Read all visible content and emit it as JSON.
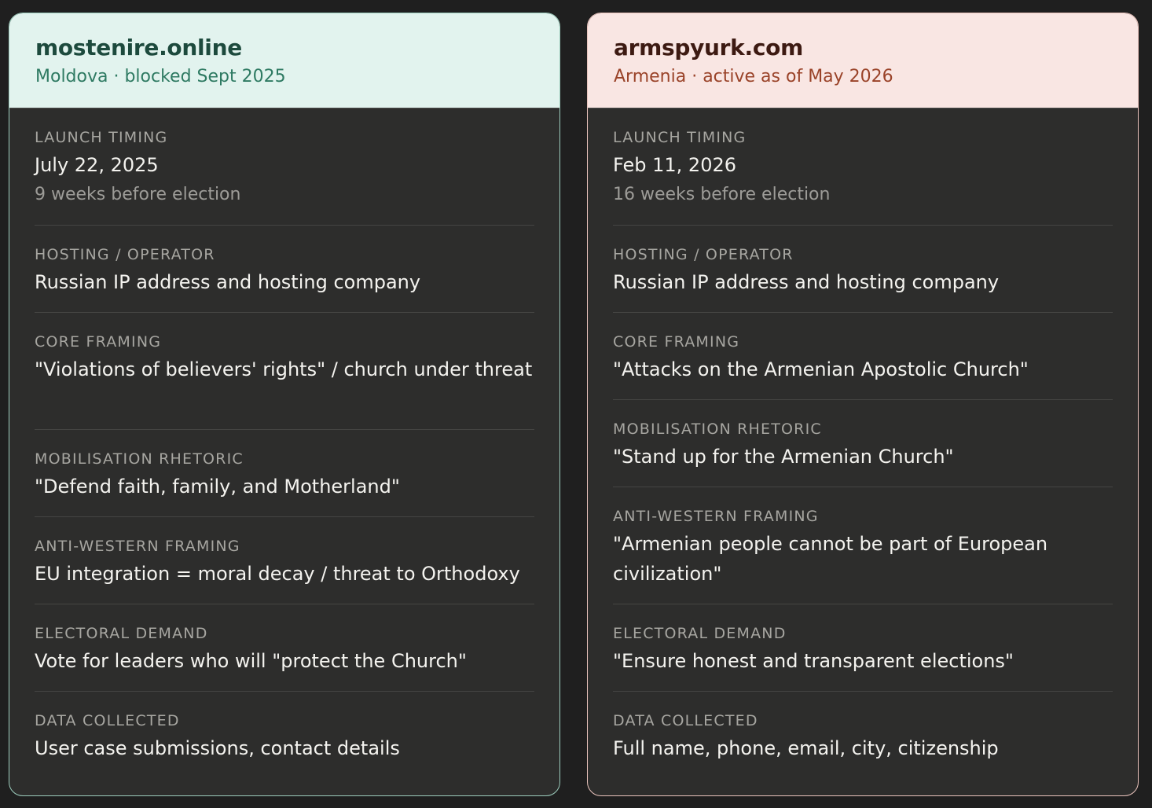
{
  "cards": [
    {
      "domain": "mostenire.online",
      "subtitle": "Moldova · blocked Sept 2025",
      "accent": "#e2f3ee",
      "rows": [
        {
          "label": "LAUNCH TIMING",
          "value": "July 22, 2025",
          "note": "9 weeks before election"
        },
        {
          "label": "HOSTING / OPERATOR",
          "value": "Russian IP address and hosting company"
        },
        {
          "label": "CORE FRAMING",
          "value": "\"Violations of believers' rights\" / church under threat"
        },
        {
          "label": "MOBILISATION RHETORIC",
          "value": "\"Defend faith, family, and Motherland\""
        },
        {
          "label": "ANTI-WESTERN FRAMING",
          "value": "EU integration = moral decay / threat to Orthodoxy"
        },
        {
          "label": "ELECTORAL DEMAND",
          "value": "Vote for leaders who will \"protect the Church\""
        },
        {
          "label": "DATA COLLECTED",
          "value": "User case submissions, contact details"
        }
      ]
    },
    {
      "domain": "armspyurk.com",
      "subtitle": "Armenia · active as of May 2026",
      "accent": "#f9e6e3",
      "rows": [
        {
          "label": "LAUNCH TIMING",
          "value": "Feb 11, 2026",
          "note": "16 weeks before election"
        },
        {
          "label": "HOSTING / OPERATOR",
          "value": "Russian IP address and hosting company"
        },
        {
          "label": "CORE FRAMING",
          "value": "\"Attacks on the Armenian Apostolic Church\""
        },
        {
          "label": "MOBILISATION RHETORIC",
          "value": "\"Stand up for the Armenian Church\""
        },
        {
          "label": "ANTI-WESTERN FRAMING",
          "value": "\"Armenian people cannot be part of European civilization\""
        },
        {
          "label": "ELECTORAL DEMAND",
          "value": "\"Ensure honest and transparent elections\""
        },
        {
          "label": "DATA COLLECTED",
          "value": "Full name, phone, email, city, citizenship"
        }
      ]
    }
  ]
}
